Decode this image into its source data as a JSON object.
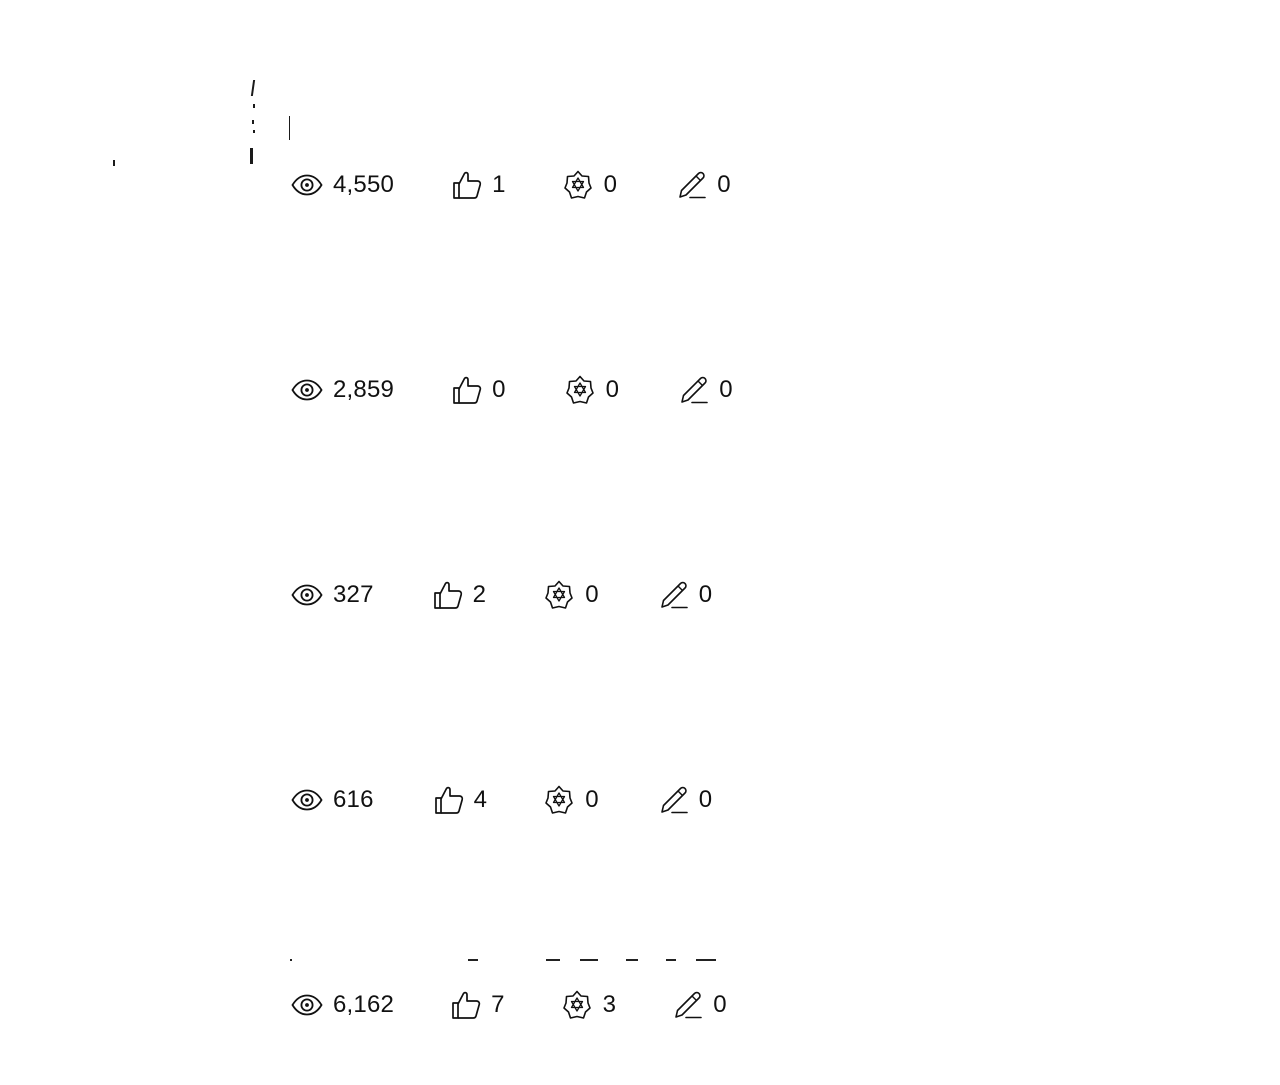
{
  "feed": {
    "items": [
      {
        "views": "4,550",
        "likes": "1",
        "reactions": "0",
        "edits": "0"
      },
      {
        "views": "2,859",
        "likes": "0",
        "reactions": "0",
        "edits": "0"
      },
      {
        "views": "327",
        "likes": "2",
        "reactions": "0",
        "edits": "0"
      },
      {
        "views": "616",
        "likes": "4",
        "reactions": "0",
        "edits": "0"
      },
      {
        "views": "6,162",
        "likes": "7",
        "reactions": "3",
        "edits": "0"
      }
    ],
    "icons": {
      "views": "eye-icon",
      "likes": "thumbs-up-icon",
      "reactions": "reaction-icon",
      "edits": "pencil-icon"
    },
    "colors": {
      "text": "#111111",
      "background": "#ffffff"
    }
  }
}
